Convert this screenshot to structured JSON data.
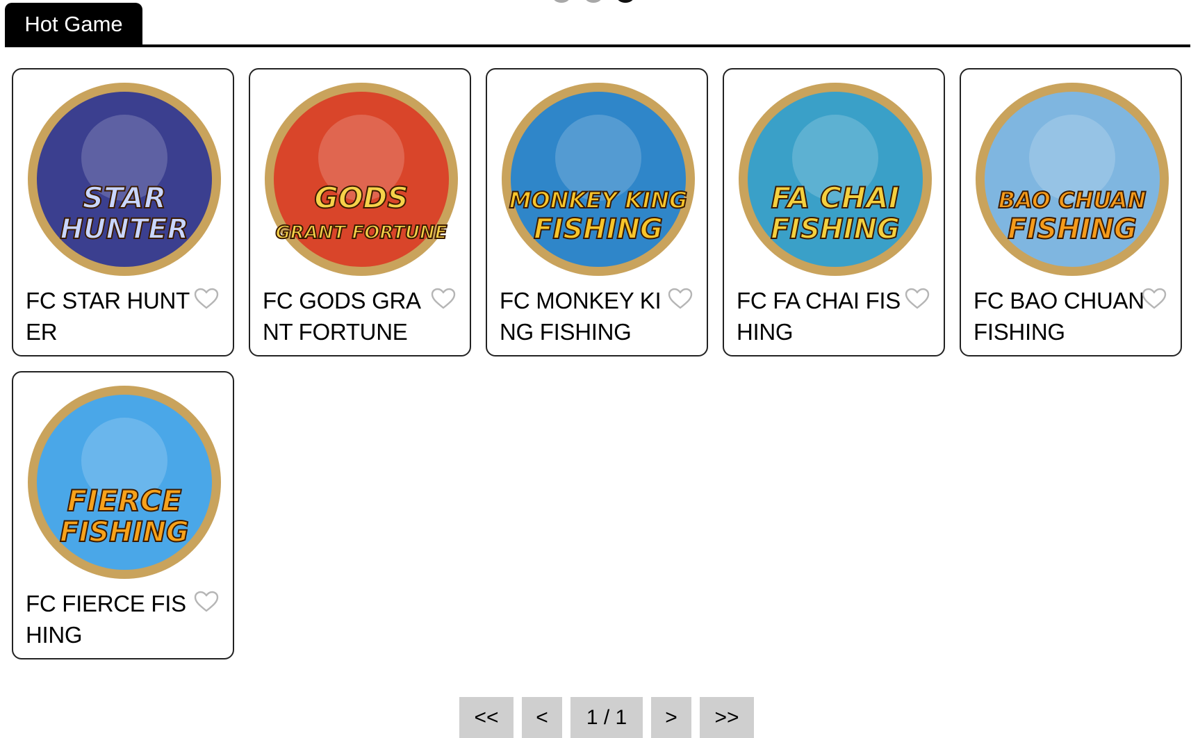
{
  "carousel": {
    "dot_count": 3,
    "active_index": 2
  },
  "tab": {
    "label": "Hot Game"
  },
  "games": [
    {
      "title": "FC STAR HUNTER",
      "art_line1": "STAR",
      "art_line2": "HUNTER",
      "bg": "#3b3f8f",
      "art_color": "#c9d6ff"
    },
    {
      "title": "FC GODS GRANT FORTUNE",
      "art_line1": "GODS",
      "art_line2": "GRANT FORTUNE",
      "bg": "#d9452a",
      "art_color": "#f6d24a"
    },
    {
      "title": "FC MONKEY KING FISHING",
      "art_line1": "MONKEY KING",
      "art_line2": "FISHING",
      "bg": "#2f86c9",
      "art_color": "#f7c52b"
    },
    {
      "title": "FC FA CHAI FISHING",
      "art_line1": "FA CHAI",
      "art_line2": "FISHING",
      "bg": "#3aa0c8",
      "art_color": "#f4d03f"
    },
    {
      "title": "FC BAO CHUAN FISHING",
      "art_line1": "BAO CHUAN",
      "art_line2": "FISHING",
      "bg": "#7fb6e0",
      "art_color": "#f59b1b"
    },
    {
      "title": "FC FIERCE FISHING",
      "art_line1": "FIERCE",
      "art_line2": "FISHING",
      "bg": "#4aa7e8",
      "art_color": "#f7a21b"
    }
  ],
  "pagination": {
    "first": "<<",
    "prev": "<",
    "page": "1 / 1",
    "next": ">",
    "last": ">>"
  },
  "colors": {
    "tab_bg": "#000000",
    "pager_bg": "#cfcfcf",
    "heart": "#b5b5b5",
    "ring": "#c9a35c"
  }
}
